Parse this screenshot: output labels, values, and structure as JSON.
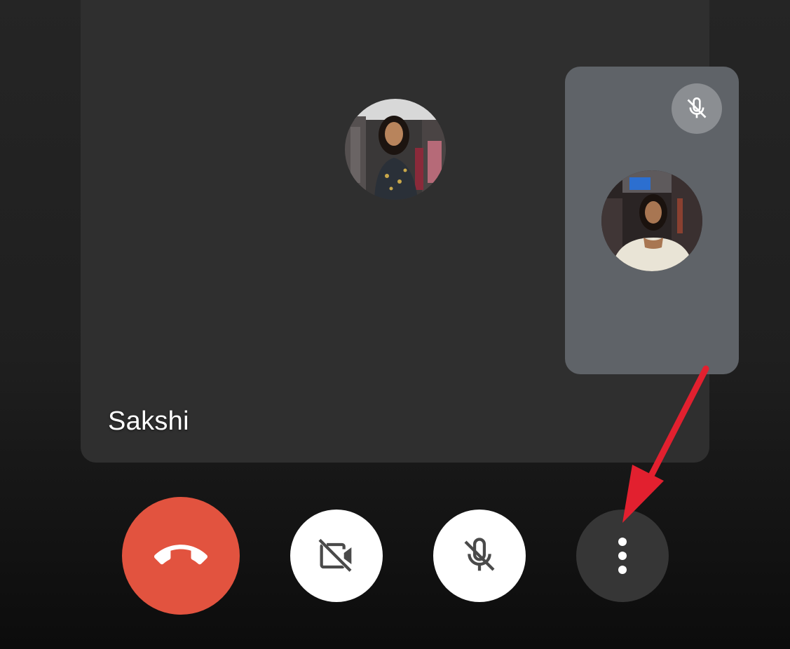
{
  "participant": {
    "name": "Sakshi",
    "avatar_icon": "participant-photo-avatar"
  },
  "self_view": {
    "avatar_icon": "self-photo-avatar",
    "mute_indicator_icon": "mic-off-icon",
    "muted": true
  },
  "controls": {
    "end_call_icon": "phone-hangup-icon",
    "camera_icon": "video-off-icon",
    "mic_icon": "mic-off-icon",
    "more_icon": "more-vertical-icon"
  },
  "colors": {
    "end_call": "#e2533f",
    "annotation_arrow": "#e2202f",
    "tile_bg": "#2f2f2f",
    "self_tile_bg": "#5f6368"
  }
}
